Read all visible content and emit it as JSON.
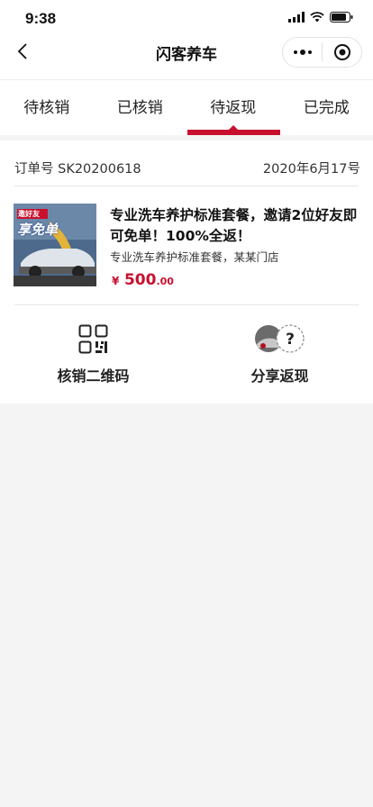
{
  "status_bar": {
    "time": "9:38"
  },
  "nav": {
    "title": "闪客养车"
  },
  "tabs": [
    {
      "label": "待核销",
      "active": false
    },
    {
      "label": "已核销",
      "active": false
    },
    {
      "label": "待返现",
      "active": true
    },
    {
      "label": "已完成",
      "active": false
    }
  ],
  "order": {
    "number_label": "订单号",
    "number": "SK20200618",
    "date": "2020年6月17号",
    "product": {
      "title": "专业洗车养护标准套餐，邀请2位好友即可免单！100%全返！",
      "subtitle": "专业洗车养护标准套餐，某某门店",
      "price_currency": "¥",
      "price_integer": "500",
      "price_decimal": ".00",
      "image_text_top": "邀好友",
      "image_text_main": "享免单"
    },
    "actions": [
      {
        "label": "核销二维码",
        "icon": "qr-code-icon"
      },
      {
        "label": "分享返现",
        "icon": "share-avatars-icon"
      }
    ]
  },
  "colors": {
    "accent": "#c8102e",
    "background": "#f4f4f4"
  }
}
